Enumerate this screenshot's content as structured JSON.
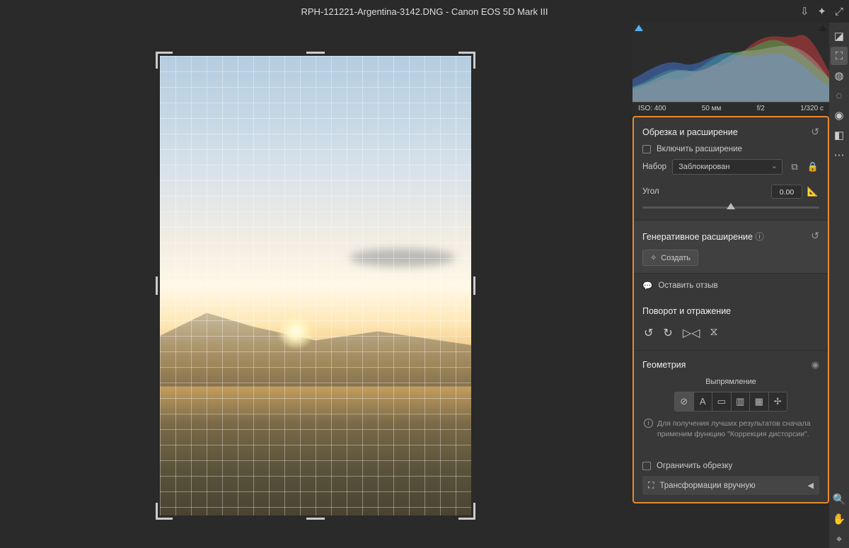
{
  "title": "RPH-121221-Argentina-3142.DNG  -  Canon EOS 5D Mark III",
  "histogram": {
    "iso": "ISO: 400",
    "focal": "50 мм",
    "aperture": "f/2",
    "shutter": "1/320 с"
  },
  "crop": {
    "title": "Обрезка и расширение",
    "enable_expand": "Включить расширение",
    "preset_label": "Набор",
    "preset_value": "Заблокирован",
    "angle_label": "Угол",
    "angle_value": "0.00"
  },
  "gen": {
    "title": "Генеративное расширение",
    "create": "Создать"
  },
  "feedback": "Оставить отзыв",
  "rotate": {
    "title": "Поворот и отражение"
  },
  "geometry": {
    "title": "Геометрия",
    "upright": "Выпрямление",
    "info": "Для получения лучших результатов сначала применим функцию \"Коррекция дисторсии\".",
    "constrain": "Ограничить обрезку",
    "manual": "Трансформации вручную"
  }
}
